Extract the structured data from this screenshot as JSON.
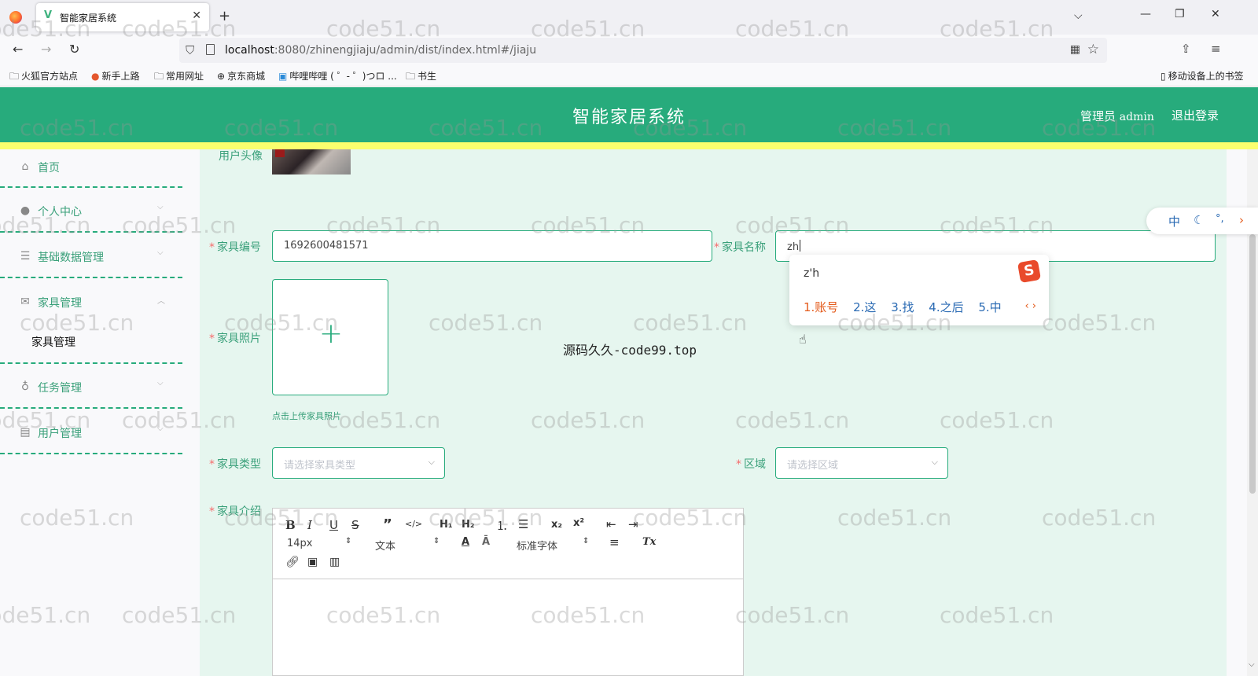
{
  "browser": {
    "tab_title": "智能家居系统",
    "url_host": "localhost",
    "url_rest": ":8080/zhinengjiaju/admin/dist/index.html#/jiaju",
    "bookmarks": [
      "火狐官方站点",
      "新手上路",
      "常用网址",
      "京东商城",
      "哔哩哔哩 ( ゜- ゜)つロ ...",
      "书生"
    ],
    "mobile_bookmarks": "移动设备上的书签"
  },
  "header": {
    "title": "智能家居系统",
    "admin_label": "管理员",
    "admin_name": "admin",
    "logout": "退出登录"
  },
  "sidebar": {
    "items": [
      {
        "label": "首页",
        "icon": "home-icon"
      },
      {
        "label": "个人中心",
        "icon": "user-icon",
        "expanded": false
      },
      {
        "label": "基础数据管理",
        "icon": "sliders-icon",
        "expanded": false
      },
      {
        "label": "家具管理",
        "icon": "mail-icon",
        "expanded": true
      },
      {
        "label": "任务管理",
        "icon": "mic-icon",
        "expanded": false
      },
      {
        "label": "用户管理",
        "icon": "id-card-icon",
        "expanded": false
      }
    ],
    "submenu_active": "家具管理"
  },
  "form": {
    "avatar_label": "用户头像",
    "code_label": "家具编号",
    "code_value": "1692600481571",
    "name_label": "家具名称",
    "name_value": "zh",
    "photo_label": "家具照片",
    "upload_tip": "点击上传家具照片",
    "type_label": "家具类型",
    "type_placeholder": "请选择家具类型",
    "area_label": "区域",
    "area_placeholder": "请选择区域",
    "intro_label": "家具介绍",
    "font_size": "14px",
    "text_style": "文本",
    "font_family": "标准字体"
  },
  "ime": {
    "input": "z'h",
    "candidates": [
      "1.账号",
      "2.这",
      "3.找",
      "4.之后",
      "5.中"
    ],
    "status_char": "中"
  },
  "overlay_text": "源码久久-code99.top",
  "watermark": "code51.cn",
  "colors": {
    "primary": "#27ab7c",
    "strip": "#fbff6e",
    "main_bg": "#e6f6ef",
    "required": "#f56c6c"
  }
}
